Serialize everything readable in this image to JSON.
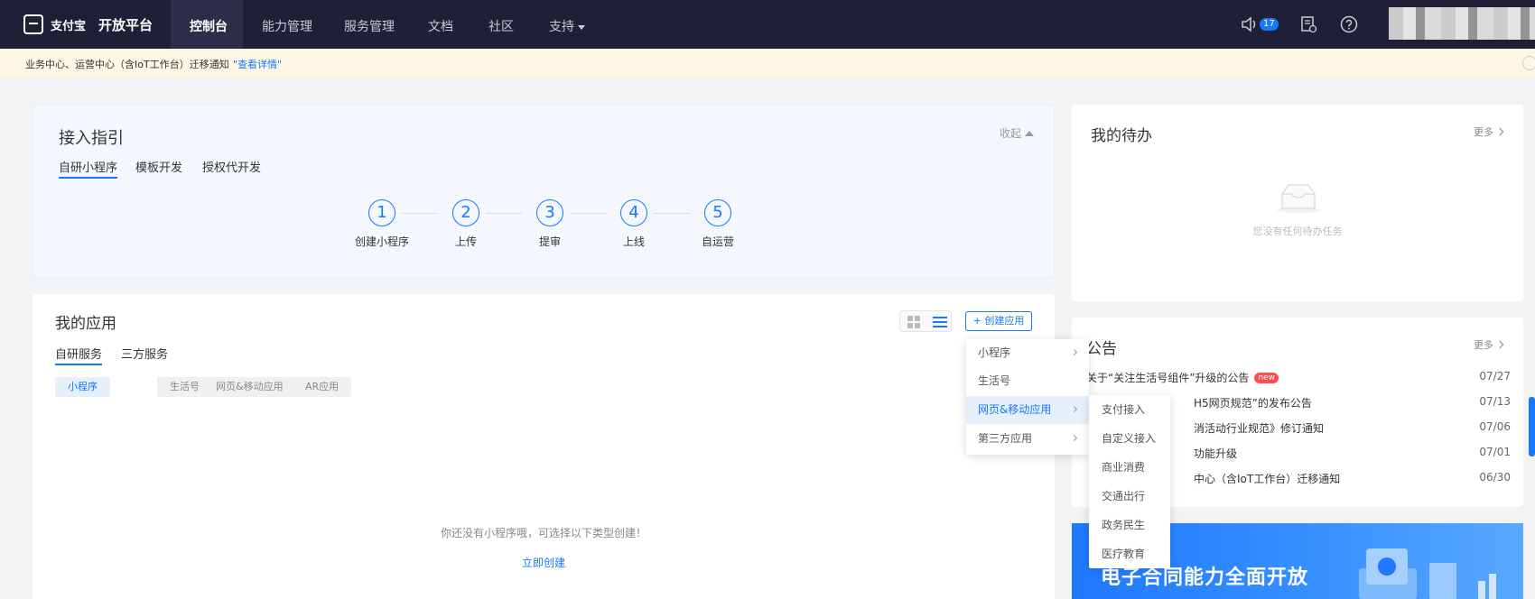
{
  "topnav": {
    "logo_text": "支付宝",
    "platform_name": "开放平台",
    "items": [
      {
        "label": "控制台"
      },
      {
        "label": "能力管理"
      },
      {
        "label": "服务管理"
      },
      {
        "label": "文档"
      },
      {
        "label": "社区"
      },
      {
        "label": "支持"
      }
    ],
    "notification_count": "17"
  },
  "notice": {
    "text": "业务中心、运营中心（含IoT工作台）迁移通知",
    "link": "\"查看详情\""
  },
  "guide": {
    "title": "接入指引",
    "collapse_label": "收起",
    "tabs": [
      {
        "label": "自研小程序"
      },
      {
        "label": "模板开发"
      },
      {
        "label": "授权代开发"
      }
    ],
    "steps": [
      {
        "num": "1",
        "label": "创建小程序"
      },
      {
        "num": "2",
        "label": "上传"
      },
      {
        "num": "3",
        "label": "提审"
      },
      {
        "num": "4",
        "label": "上线"
      },
      {
        "num": "5",
        "label": "自运营"
      }
    ]
  },
  "apps": {
    "title": "我的应用",
    "create_label": "+ 创建应用",
    "tabs": [
      {
        "label": "自研服务"
      },
      {
        "label": "三方服务"
      }
    ],
    "types": [
      {
        "label": "小程序"
      },
      {
        "label": "生活号"
      },
      {
        "label": "网页&移动应用"
      },
      {
        "label": "AR应用"
      }
    ],
    "empty_text": "你还没有小程序哦，可选择以下类型创建！",
    "empty_link": "立即创建"
  },
  "create_menu": {
    "items": [
      {
        "label": "小程序"
      },
      {
        "label": "生活号"
      },
      {
        "label": "网页&移动应用"
      },
      {
        "label": "第三方应用"
      }
    ],
    "sub_items": [
      {
        "label": "支付接入"
      },
      {
        "label": "自定义接入"
      },
      {
        "label": "商业消费"
      },
      {
        "label": "交通出行"
      },
      {
        "label": "政务民生"
      },
      {
        "label": "医疗教育"
      }
    ]
  },
  "todo": {
    "title": "我的待办",
    "more_label": "更多",
    "empty_text": "您没有任何待办任务"
  },
  "announcements": {
    "title": "公告",
    "more_label": "更多",
    "new_tag": "new",
    "rows": [
      {
        "title": "关于“关注生活号组件”升级的公告",
        "date": "07/27"
      },
      {
        "title": "H5网页规范”的发布公告",
        "date": "07/13"
      },
      {
        "title": "消活动行业规范》修订通知",
        "date": "07/06"
      },
      {
        "title": "功能升级",
        "date": "07/01"
      },
      {
        "title": "中心（含IoT工作台）迁移通知",
        "date": "06/30"
      }
    ]
  },
  "banner": {
    "title": "电子合同能力全面开放"
  },
  "colors": {
    "nav_bg": "#1f2038",
    "accent": "#1677ff",
    "notice_bg": "#fdf6e5",
    "new_tag": "#ff4d4f"
  },
  "icons": [
    "alipay-logo-icon",
    "speaker-icon",
    "document-icon",
    "help-icon",
    "grid-view-icon",
    "list-view-icon",
    "inbox-icon",
    "chevron-right-icon"
  ]
}
